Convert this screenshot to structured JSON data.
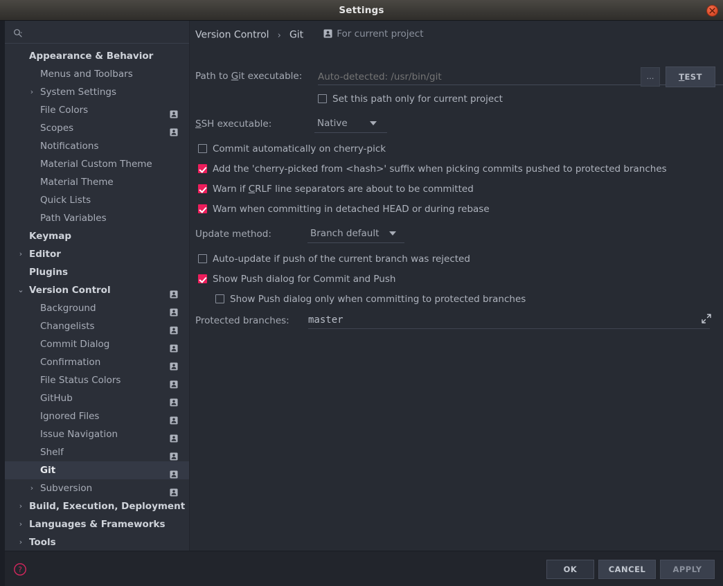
{
  "window": {
    "title": "Settings",
    "close_icon": "close-icon"
  },
  "sidebar": {
    "search": {
      "value": "",
      "placeholder": "",
      "icon": "search-icon"
    },
    "items": [
      {
        "label": "Appearance & Behavior",
        "level": 0,
        "arrow": "",
        "badge": false,
        "selected": false
      },
      {
        "label": "Menus and Toolbars",
        "level": 1,
        "arrow": "",
        "badge": false,
        "selected": false
      },
      {
        "label": "System Settings",
        "level": 1,
        "arrow": "›",
        "badge": false,
        "selected": false
      },
      {
        "label": "File Colors",
        "level": 1,
        "arrow": "",
        "badge": true,
        "selected": false
      },
      {
        "label": "Scopes",
        "level": 1,
        "arrow": "",
        "badge": true,
        "selected": false
      },
      {
        "label": "Notifications",
        "level": 1,
        "arrow": "",
        "badge": false,
        "selected": false
      },
      {
        "label": "Material Custom Theme",
        "level": 1,
        "arrow": "",
        "badge": false,
        "selected": false
      },
      {
        "label": "Material Theme",
        "level": 1,
        "arrow": "",
        "badge": false,
        "selected": false
      },
      {
        "label": "Quick Lists",
        "level": 1,
        "arrow": "",
        "badge": false,
        "selected": false
      },
      {
        "label": "Path Variables",
        "level": 1,
        "arrow": "",
        "badge": false,
        "selected": false
      },
      {
        "label": "Keymap",
        "level": 0,
        "arrow": "",
        "badge": false,
        "selected": false
      },
      {
        "label": "Editor",
        "level": 0,
        "arrow": "›",
        "badge": false,
        "selected": false
      },
      {
        "label": "Plugins",
        "level": 0,
        "arrow": "",
        "badge": false,
        "selected": false
      },
      {
        "label": "Version Control",
        "level": 0,
        "arrow": "⌄",
        "badge": true,
        "selected": false
      },
      {
        "label": "Background",
        "level": 1,
        "arrow": "",
        "badge": true,
        "selected": false
      },
      {
        "label": "Changelists",
        "level": 1,
        "arrow": "",
        "badge": true,
        "selected": false
      },
      {
        "label": "Commit Dialog",
        "level": 1,
        "arrow": "",
        "badge": true,
        "selected": false
      },
      {
        "label": "Confirmation",
        "level": 1,
        "arrow": "",
        "badge": true,
        "selected": false
      },
      {
        "label": "File Status Colors",
        "level": 1,
        "arrow": "",
        "badge": true,
        "selected": false
      },
      {
        "label": "GitHub",
        "level": 1,
        "arrow": "",
        "badge": true,
        "selected": false
      },
      {
        "label": "Ignored Files",
        "level": 1,
        "arrow": "",
        "badge": true,
        "selected": false
      },
      {
        "label": "Issue Navigation",
        "level": 1,
        "arrow": "",
        "badge": true,
        "selected": false
      },
      {
        "label": "Shelf",
        "level": 1,
        "arrow": "",
        "badge": true,
        "selected": false
      },
      {
        "label": "Git",
        "level": 1,
        "arrow": "",
        "badge": true,
        "selected": true
      },
      {
        "label": "Subversion",
        "level": 1,
        "arrow": "›",
        "badge": true,
        "selected": false
      },
      {
        "label": "Build, Execution, Deployment",
        "level": 0,
        "arrow": "›",
        "badge": false,
        "selected": false
      },
      {
        "label": "Languages & Frameworks",
        "level": 0,
        "arrow": "›",
        "badge": false,
        "selected": false
      },
      {
        "label": "Tools",
        "level": 0,
        "arrow": "›",
        "badge": false,
        "selected": false
      }
    ]
  },
  "breadcrumb": {
    "parent": "Version Control",
    "separator": "›",
    "current": "Git",
    "project_scope": "For current project",
    "project_icon": "project-badge-icon"
  },
  "main": {
    "path_label_pre": "Path to ",
    "path_label_mnemonic": "G",
    "path_label_post": "it executable:",
    "path_value": "",
    "path_placeholder": "Auto-detected: /usr/bin/git",
    "browse_label": "…",
    "test_label_mnemonic": "T",
    "test_label_rest": "EST",
    "set_path_project_label": "Set this path only for current project",
    "set_path_project_checked": false,
    "ssh_label_mnemonic": "S",
    "ssh_label_rest": "SH executable:",
    "ssh_value": "Native",
    "commit_cherry_label": "Commit automatically on cherry-pick",
    "commit_cherry_checked": false,
    "cherry_suffix_label": "Add the 'cherry-picked from <hash>' suffix when picking commits pushed to protected branches",
    "cherry_suffix_checked": true,
    "crlf_label_pre": "Warn if ",
    "crlf_label_mnemonic": "C",
    "crlf_label_post": "RLF line separators are about to be committed",
    "crlf_checked": true,
    "detached_label": "Warn when committing in detached HEAD or during rebase",
    "detached_checked": true,
    "update_method_label": "Update method:",
    "update_method_value": "Branch default",
    "autoupdate_label": "Auto-update if push of the current branch was rejected",
    "autoupdate_checked": false,
    "show_push_label": "Show Push dialog for Commit and Push",
    "show_push_checked": true,
    "show_push_protected_label": "Show Push dialog only when committing to protected branches",
    "show_push_protected_checked": false,
    "protected_branches_label": "Protected branches:",
    "protected_branches_value": "master",
    "expand_icon": "expand-icon"
  },
  "footer": {
    "help_icon": "help-icon",
    "ok_label": "OK",
    "cancel_label": "CANCEL",
    "apply_label": "APPLY"
  },
  "colors": {
    "accent": "#ec1d5b",
    "scrollbar": "#7a2a4d",
    "window_bg": "#272b33",
    "sidebar_bg": "#2b2f38",
    "close_btn": "#e0522f"
  }
}
